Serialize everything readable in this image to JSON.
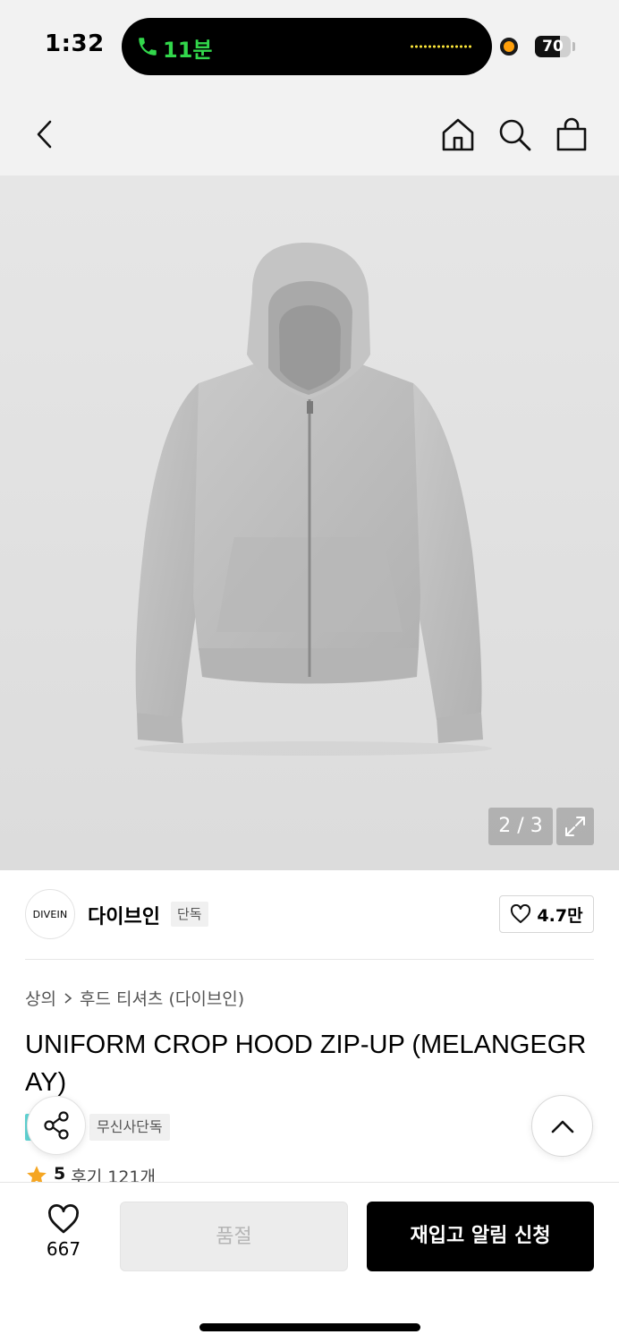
{
  "status_bar": {
    "time": "1:32",
    "call_duration": "11분",
    "battery_level": "70",
    "battery_fraction": 0.7
  },
  "nav": {
    "icons": [
      "back-icon",
      "home-icon",
      "search-icon",
      "bag-icon"
    ]
  },
  "gallery": {
    "page_indicator": "2 / 3"
  },
  "brand": {
    "logo_text": "DIVEIN",
    "name": "다이브인",
    "tag": "단독",
    "likes": "4.7만"
  },
  "product": {
    "breadcrumb_category": "상의",
    "breadcrumb_subcategory": "후드 티셔츠 (다이브인)",
    "title": "UNIFORM CROP HOOD ZIP-UP (MELANGEGRAY)",
    "tag": "무신사단독",
    "rating": "5",
    "review_label": "후기 121개"
  },
  "bottom_bar": {
    "wish_count": "667",
    "soldout_label": "품절",
    "restock_label": "재입고 알림 신청"
  },
  "colors": {
    "accent": "#000000",
    "call_green": "#32d74b",
    "star": "#f5a623"
  }
}
